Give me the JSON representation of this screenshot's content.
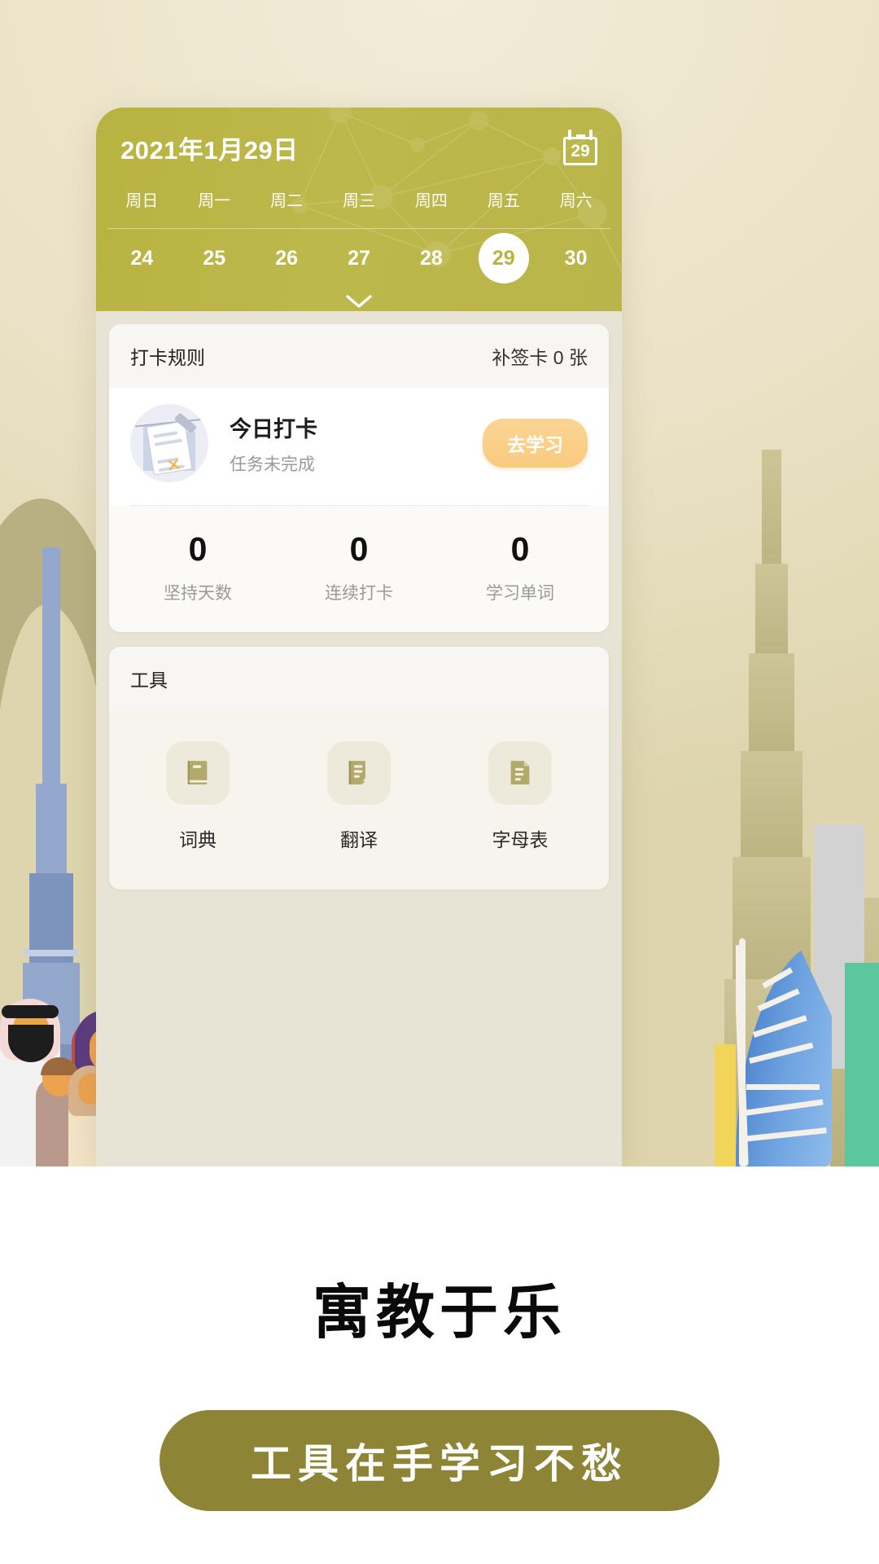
{
  "header": {
    "date_title": "2021年1月29日",
    "calendar_icon_day": "29",
    "weekdays": [
      "周日",
      "周一",
      "周二",
      "周三",
      "周四",
      "周五",
      "周六"
    ],
    "days": [
      "24",
      "25",
      "26",
      "27",
      "28",
      "29",
      "30"
    ],
    "selected_day": "29",
    "expand_icon": "chevron-down-icon",
    "bg_color": "#bab54a"
  },
  "checkin_card": {
    "rules_label": "打卡规则",
    "makeup_cards_label": "补签卡 0 张",
    "task_title": "今日打卡",
    "task_subtitle": "任务未完成",
    "action_label": "去学习",
    "action_color": "#f9cb7f",
    "stats": [
      {
        "value": "0",
        "label": "坚持天数"
      },
      {
        "value": "0",
        "label": "连续打卡"
      },
      {
        "value": "0",
        "label": "学习单词"
      }
    ]
  },
  "tools_card": {
    "title": "工具",
    "items": [
      {
        "label": "词典",
        "icon": "book-icon"
      },
      {
        "label": "翻译",
        "icon": "translate-document-icon"
      },
      {
        "label": "字母表",
        "icon": "document-text-icon"
      }
    ],
    "icon_color": "#b3a96a"
  },
  "caption": {
    "headline": "寓教于乐",
    "button_label": "工具在手学习不愁",
    "button_color": "#8d8535"
  }
}
